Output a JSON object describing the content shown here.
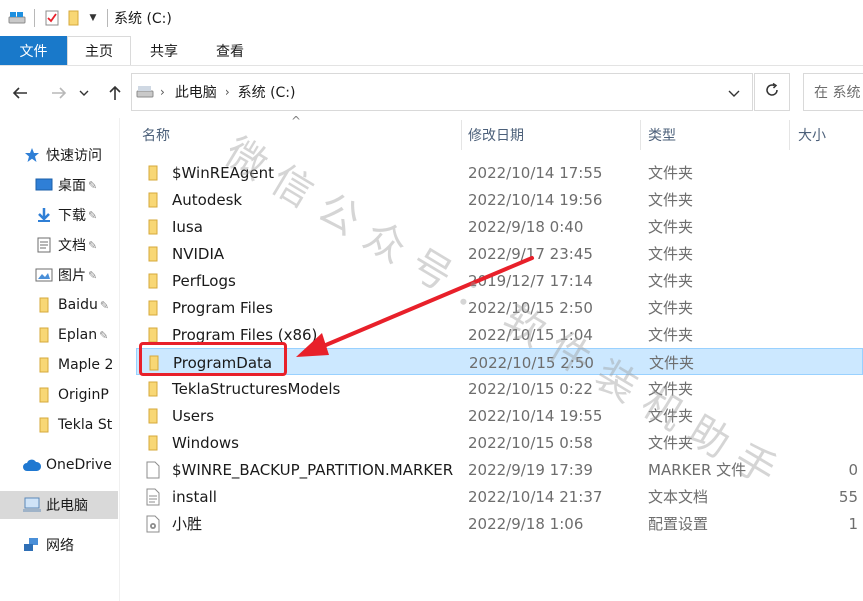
{
  "titlebar": {
    "title": "系统 (C:)"
  },
  "ribbon": {
    "tabs": [
      "文件",
      "主页",
      "共享",
      "查看"
    ]
  },
  "address": {
    "crumbs": [
      "此电脑",
      "系统 (C:)"
    ],
    "search_placeholder": "在 系统"
  },
  "sidebar": {
    "items": [
      {
        "label": "快速访问",
        "icon": "star-icon",
        "pinned": false
      },
      {
        "label": "桌面",
        "icon": "desktop-icon",
        "pinned": true
      },
      {
        "label": "下载",
        "icon": "download-icon",
        "pinned": true
      },
      {
        "label": "文档",
        "icon": "document-icon",
        "pinned": true
      },
      {
        "label": "图片",
        "icon": "picture-icon",
        "pinned": true
      },
      {
        "label": "Baidu",
        "icon": "folder-icon",
        "pinned": true
      },
      {
        "label": "Eplan",
        "icon": "folder-icon",
        "pinned": true
      },
      {
        "label": "Maple 2",
        "icon": "folder-icon",
        "pinned": false
      },
      {
        "label": "OriginP",
        "icon": "folder-icon",
        "pinned": false
      },
      {
        "label": "Tekla St",
        "icon": "folder-icon",
        "pinned": false
      },
      {
        "label": "OneDrive",
        "icon": "cloud-icon",
        "pinned": false
      },
      {
        "label": "此电脑",
        "icon": "computer-icon",
        "pinned": false
      },
      {
        "label": "网络",
        "icon": "network-icon",
        "pinned": false
      }
    ],
    "selected_index": 11
  },
  "columns": {
    "name": "名称",
    "date": "修改日期",
    "type": "类型",
    "size": "大小"
  },
  "files": [
    {
      "name": "$WinREAgent",
      "date": "2022/10/14 17:55",
      "type": "文件夹",
      "size": "",
      "icon": "folder-icon"
    },
    {
      "name": "Autodesk",
      "date": "2022/10/14 19:56",
      "type": "文件夹",
      "size": "",
      "icon": "folder-icon"
    },
    {
      "name": "Iusa",
      "date": "2022/9/18 0:40",
      "type": "文件夹",
      "size": "",
      "icon": "folder-icon"
    },
    {
      "name": "NVIDIA",
      "date": "2022/9/17 23:45",
      "type": "文件夹",
      "size": "",
      "icon": "folder-icon"
    },
    {
      "name": "PerfLogs",
      "date": "2019/12/7 17:14",
      "type": "文件夹",
      "size": "",
      "icon": "folder-icon"
    },
    {
      "name": "Program Files",
      "date": "2022/10/15 2:50",
      "type": "文件夹",
      "size": "",
      "icon": "folder-icon"
    },
    {
      "name": "Program Files (x86)",
      "date": "2022/10/15 1:04",
      "type": "文件夹",
      "size": "",
      "icon": "folder-icon"
    },
    {
      "name": "ProgramData",
      "date": "2022/10/15 2:50",
      "type": "文件夹",
      "size": "",
      "icon": "folder-icon"
    },
    {
      "name": "TeklaStructuresModels",
      "date": "2022/10/15 0:22",
      "type": "文件夹",
      "size": "",
      "icon": "folder-icon"
    },
    {
      "name": "Users",
      "date": "2022/10/14 19:55",
      "type": "文件夹",
      "size": "",
      "icon": "folder-icon"
    },
    {
      "name": "Windows",
      "date": "2022/10/15 0:58",
      "type": "文件夹",
      "size": "",
      "icon": "folder-icon"
    },
    {
      "name": "$WINRE_BACKUP_PARTITION.MARKER",
      "date": "2022/9/19 17:39",
      "type": "MARKER 文件",
      "size": "0",
      "icon": "file-icon"
    },
    {
      "name": "install",
      "date": "2022/10/14 21:37",
      "type": "文本文档",
      "size": "55",
      "icon": "text-file-icon"
    },
    {
      "name": "小胜",
      "date": "2022/9/18 1:06",
      "type": "配置设置",
      "size": "1",
      "icon": "settings-file-icon"
    }
  ],
  "selected_file_index": 7,
  "watermark": {
    "text": "微信公众号：软件装机助手"
  },
  "colors": {
    "accent": "#1979ca",
    "selection": "#cce8ff",
    "annotation": "#e8202a",
    "folder": "#f8d775"
  }
}
